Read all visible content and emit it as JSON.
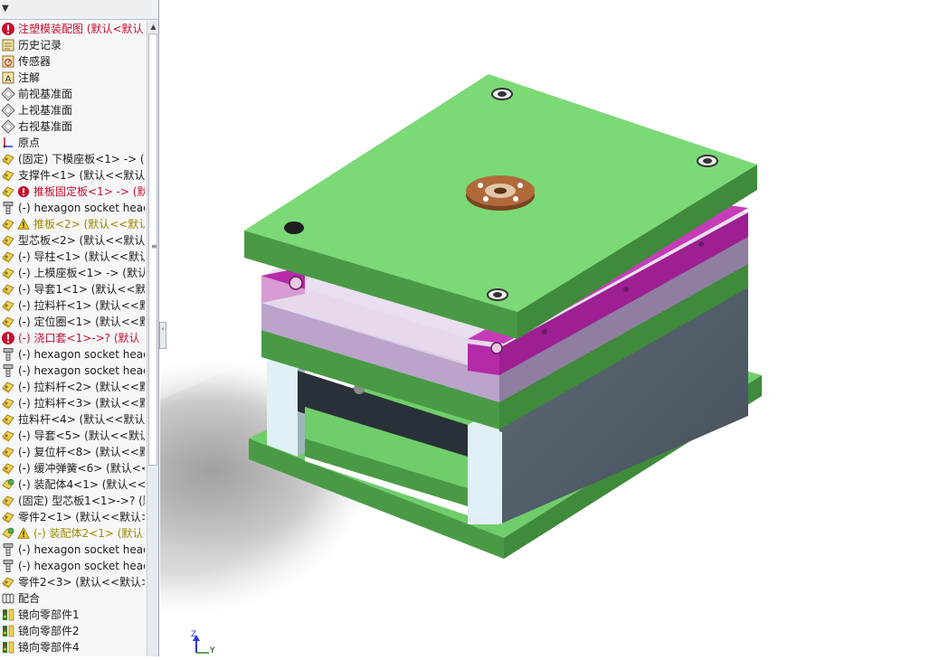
{
  "panel": {
    "collapse_icon": "chevron-down-icon",
    "scroll_up_icon": "arrow-up-icon",
    "splitter_icon": "chevron-left-icon"
  },
  "tree_items": [
    {
      "label": "注塑模装配图 (默认<默认",
      "icon": "error-assembly-icon",
      "status": "error",
      "color": "#c8102e"
    },
    {
      "label": "历史记录",
      "icon": "history-icon"
    },
    {
      "label": "传感器",
      "icon": "sensor-icon"
    },
    {
      "label": "注解",
      "icon": "annotation-icon"
    },
    {
      "label": "前视基准面",
      "icon": "plane-icon"
    },
    {
      "label": "上视基准面",
      "icon": "plane-icon"
    },
    {
      "label": "右视基准面",
      "icon": "plane-icon"
    },
    {
      "label": "原点",
      "icon": "origin-icon"
    },
    {
      "label": "(固定) 下模座板<1> -> (",
      "icon": "part-icon"
    },
    {
      "label": "支撑件<1> (默认<<默认>",
      "icon": "part-icon"
    },
    {
      "label": "推板固定板<1> -> (默",
      "icon": "part-icon",
      "icon2": "error-icon",
      "status": "error",
      "color": "#c8102e"
    },
    {
      "label": "(-) hexagon socket head",
      "icon": "screw-icon"
    },
    {
      "label": "推板<2> (默认<<默认",
      "icon": "part-icon",
      "icon2": "warning-icon",
      "status": "warning",
      "color": "#9c8a00"
    },
    {
      "label": "型芯板<2> (默认<<默认>",
      "icon": "part-icon"
    },
    {
      "label": "(-) 导柱<1> (默认<<默认",
      "icon": "part-icon"
    },
    {
      "label": "(-) 上模座板<1> -> (默认",
      "icon": "part-icon"
    },
    {
      "label": "(-) 导套1<1> (默认<<默认",
      "icon": "part-icon"
    },
    {
      "label": "(-) 拉料杆<1> (默认<<默认",
      "icon": "part-icon"
    },
    {
      "label": "(-) 定位圈<1> (默认<<默认",
      "icon": "part-icon"
    },
    {
      "label": "(-) 浇口套<1>->? (默认",
      "icon": "error-part-icon",
      "status": "error",
      "color": "#c8102e"
    },
    {
      "label": "(-) hexagon socket head",
      "icon": "screw-icon"
    },
    {
      "label": "(-) hexagon socket head",
      "icon": "screw-icon"
    },
    {
      "label": "(-) 拉料杆<2> (默认<<默认",
      "icon": "part-icon"
    },
    {
      "label": "(-) 拉料杆<3> (默认<<默认",
      "icon": "part-icon"
    },
    {
      "label": "拉料杆<4> (默认<<默认>",
      "icon": "part-icon"
    },
    {
      "label": "(-) 导套<5> (默认<<默认",
      "icon": "part-icon"
    },
    {
      "label": "(-) 复位杆<8> (默认<<默认",
      "icon": "part-icon"
    },
    {
      "label": "(-) 缓冲弹簧<6> (默认<<",
      "icon": "part-icon"
    },
    {
      "label": "(-) 装配体4<1> (默认<<默",
      "icon": "subassembly-icon"
    },
    {
      "label": "(固定) 型芯板1<1>->? (默",
      "icon": "part-icon"
    },
    {
      "label": "零件2<1> (默认<<默认>",
      "icon": "part-icon"
    },
    {
      "label": "(-) 装配体2<1> (默认<",
      "icon": "subassembly-icon",
      "icon2": "warning-icon",
      "status": "warning",
      "color": "#9c8a00"
    },
    {
      "label": "(-) hexagon socket head",
      "icon": "screw-icon"
    },
    {
      "label": "(-) hexagon socket head",
      "icon": "screw-icon"
    },
    {
      "label": "零件2<3> (默认<<默认>",
      "icon": "part-icon"
    },
    {
      "label": "配合",
      "icon": "mates-icon"
    },
    {
      "label": "镜向零部件1",
      "icon": "mirror-component-icon"
    },
    {
      "label": "镜向零部件2",
      "icon": "mirror-component-icon"
    },
    {
      "label": "镜向零部件4",
      "icon": "mirror-component-icon"
    }
  ],
  "triad": {
    "z_label": "Z",
    "y_label": "Y"
  },
  "colors": {
    "plate_green": "#6fce6a",
    "plate_dark_green": "#4a9a45",
    "ejector_magenta": "#b52aa6",
    "plate_lilac": "#bba3cc",
    "steel_slate": "#55626f",
    "locating_ring": "#b06a3a",
    "error_red": "#c8102e",
    "warning_yellow": "#f0c419"
  }
}
